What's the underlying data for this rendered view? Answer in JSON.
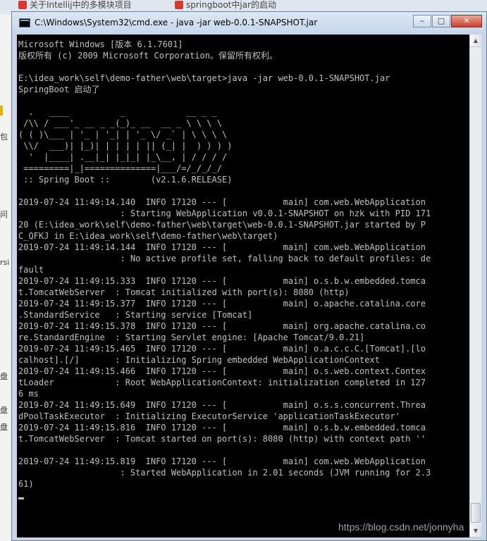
{
  "background": {
    "tabs": [
      {
        "label": "关于Intellij中的多模块项目"
      },
      {
        "label": "springboot中jar的启动"
      }
    ],
    "sidebar_fragments": [
      "包",
      "问",
      "rsi",
      "盘",
      "盘",
      "盘"
    ]
  },
  "window": {
    "title": "C:\\Windows\\System32\\cmd.exe - java  -jar web-0.0.1-SNAPSHOT.jar",
    "controls": {
      "minimize": "‒",
      "maximize": "□",
      "close": "✕"
    }
  },
  "console": {
    "lines": [
      "Microsoft Windows [版本 6.1.7601]",
      "版权所有 (c) 2009 Microsoft Corporation。保留所有权利。",
      "",
      "E:\\idea_work\\self\\demo-father\\web\\target>java -jar web-0.0.1-SNAPSHOT.jar",
      "SpringBoot 启动了",
      "",
      "  .   ____          _            __ _ _",
      " /\\\\ / ___'_ __ _ _(_)_ __  __ _ \\ \\ \\ \\",
      "( ( )\\___ | '_ | '_| | '_ \\/ _` | \\ \\ \\ \\",
      " \\\\/  ___)| |_)| | | | | || (_| |  ) ) ) )",
      "  '  |____| .__|_| |_|_| |_\\__, | / / / /",
      " =========|_|==============|___/=/_/_/_/",
      " :: Spring Boot ::        (v2.1.6.RELEASE)",
      "",
      "2019-07-24 11:49:14.140  INFO 17120 --- [           main] com.web.WebApplication",
      "                    : Starting WebApplication v0.0.1-SNAPSHOT on hzk with PID 171",
      "20 (E:\\idea_work\\self\\demo-father\\web\\target\\web-0.0.1-SNAPSHOT.jar started by P",
      "C_QFKJ in E:\\idea_work\\self\\demo-father\\web\\target)",
      "2019-07-24 11:49:14.144  INFO 17120 --- [           main] com.web.WebApplication",
      "                    : No active profile set, falling back to default profiles: de",
      "fault",
      "2019-07-24 11:49:15.333  INFO 17120 --- [           main] o.s.b.w.embedded.tomca",
      "t.TomcatWebServer  : Tomcat initialized with port(s): 8080 (http)",
      "2019-07-24 11:49:15.377  INFO 17120 --- [           main] o.apache.catalina.core",
      ".StandardService   : Starting service [Tomcat]",
      "2019-07-24 11:49:15.378  INFO 17120 --- [           main] org.apache.catalina.co",
      "re.StandardEngine  : Starting Servlet engine: [Apache Tomcat/9.0.21]",
      "2019-07-24 11:49:15.465  INFO 17120 --- [           main] o.a.c.c.C.[Tomcat].[lo",
      "calhost].[/]       : Initializing Spring embedded WebApplicationContext",
      "2019-07-24 11:49:15.466  INFO 17120 --- [           main] o.s.web.context.Contex",
      "tLoader            : Root WebApplicationContext: initialization completed in 127",
      "6 ms",
      "2019-07-24 11:49:15.649  INFO 17120 --- [           main] o.s.s.concurrent.Threa",
      "dPoolTaskExecutor  : Initializing ExecutorService 'applicationTaskExecutor'",
      "2019-07-24 11:49:15.816  INFO 17120 --- [           main] o.s.b.w.embedded.tomca",
      "t.TomcatWebServer  : Tomcat started on port(s): 8080 (http) with context path ''",
      "",
      "2019-07-24 11:49:15.819  INFO 17120 --- [           main] com.web.WebApplication",
      "                    : Started WebApplication in 2.01 seconds (JVM running for 2.3",
      "61)"
    ]
  },
  "watermark": "https://blog.csdn.net/jonnyha"
}
